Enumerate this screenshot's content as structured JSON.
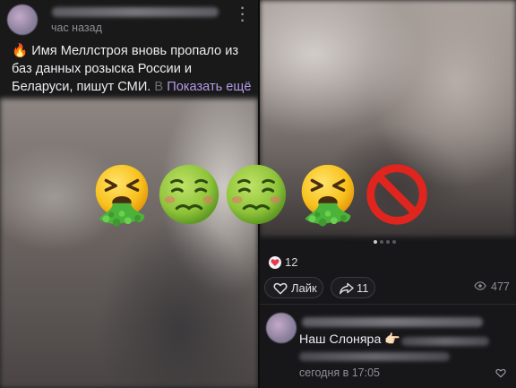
{
  "left_post": {
    "channel_name": "Постерония для программистов",
    "time": "час назад",
    "emoji": "🔥",
    "text": " Имя Меллстроя вновь пропало из баз данных розыска России и Беларуси, пишут СМИ.",
    "faded_text": " В",
    "show_more": "Показать ещё",
    "more_icon": "vertical-dots-icon"
  },
  "right_post": {
    "carousel_dots": 4,
    "carousel_active": 0,
    "reaction_icon": "heart-icon",
    "reaction_count": "12",
    "like_label": "Лайк",
    "like_icon": "heart-outline-icon",
    "share_count": "11",
    "share_icon": "share-arrow-icon",
    "views_icon": "eye-icon",
    "views_count": "477"
  },
  "comment": {
    "author": "Постерония для программистов",
    "text": "Наш Слоняра 👉🏻",
    "link_line1": "https://t.me",
    "link_line2": "/slongame_bot?start=ggUtMf...",
    "date": "сегодня в 17:05",
    "like_icon": "heart-outline-icon"
  },
  "emoji_overlay": [
    {
      "name": "vomiting-face-emoji"
    },
    {
      "name": "nauseated-face-emoji"
    },
    {
      "name": "nauseated-face-emoji"
    },
    {
      "name": "vomiting-face-emoji"
    },
    {
      "name": "prohibited-emoji"
    }
  ],
  "colors": {
    "accent_link": "#b49ae6",
    "background": "#19191a",
    "reaction_red": "#e53950"
  }
}
